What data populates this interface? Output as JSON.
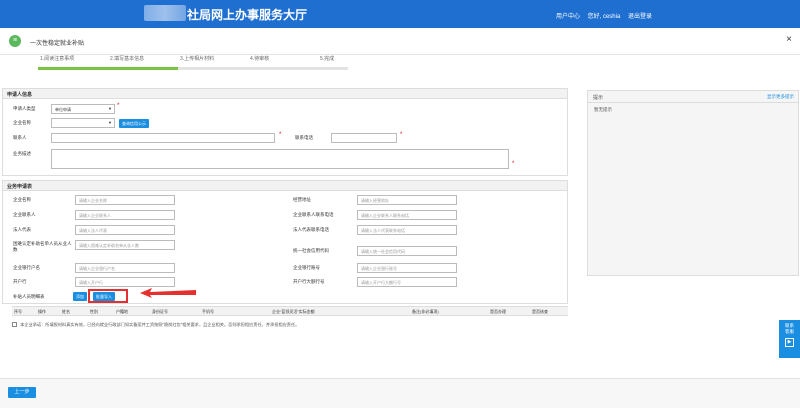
{
  "header": {
    "title": "社局网上办事服务大厅",
    "user_center": "用户中心",
    "user_name": "您好, ceshia",
    "logout": "退出登录"
  },
  "form": {
    "title": "一次性稳定就业补贴",
    "close": "×"
  },
  "steps": [
    {
      "label": "1.阅读注意事项",
      "done": true
    },
    {
      "label": "2.填写基本信息",
      "done": true
    },
    {
      "label": "3.上传相片材料",
      "done": false
    },
    {
      "label": "4.待审核",
      "done": false
    },
    {
      "label": "5.完成",
      "done": false
    }
  ],
  "applicant": {
    "section_title": "申请人信息",
    "type_label": "申请人类型",
    "type_value": "单位申请",
    "company_label": "企业名称",
    "company_btn": "查询信用公示",
    "contact_label": "联系人",
    "phone_label": "联系电话",
    "desc_label": "业务描述"
  },
  "business": {
    "section_title": "业务申请表",
    "fields": [
      {
        "label": "企业名称",
        "placeholder": "请输入企业名称"
      },
      {
        "label": "经营地址",
        "placeholder": "请输入经营地址"
      },
      {
        "label": "企业联系人",
        "placeholder": "请输入企业联系人"
      },
      {
        "label": "企业联系人联系电话",
        "placeholder": "请输入企业联系人联系电话"
      },
      {
        "label": "法人代表",
        "placeholder": "请输入法人代表"
      },
      {
        "label": "法人代表联系电话",
        "placeholder": "请输入法人代表联系电话"
      },
      {
        "label": "困难认定补助名单人员从业人数",
        "placeholder": "请输入困难认定补助名单从业人数"
      },
      {
        "label": "统一社会信用代码",
        "placeholder": "请输入统一社会信用代码"
      },
      {
        "label": "企业银行户名",
        "placeholder": "请输入企业银行户名"
      },
      {
        "label": "企业银行账号",
        "placeholder": "请输入企业银行账号"
      },
      {
        "label": "开户行",
        "placeholder": "请输入开户行"
      },
      {
        "label": "开户行大额行号",
        "placeholder": "请输入开户行大额行号"
      }
    ],
    "subsidy_label": "补贴人员明细表",
    "add_btn": "添加",
    "batch_btn": "批量导入"
  },
  "table": {
    "columns": [
      "序号",
      "操作",
      "姓名",
      "性别",
      "户籍地",
      "身份证号",
      "手机号",
      "企业“蓝领灵活”实际金额",
      "备注(非必填项)",
      "是否办理",
      "是否核查"
    ]
  },
  "agreement": "本企业承诺：所填报材料真实有效，已经向就业行政部门如实备案并工资按照“稳岗红包”相关要求，且企业相关。否则承担相应责任，并承担相应责任。",
  "tips": {
    "title": "提示",
    "toggle": "显示更多提示",
    "content": "暂无提示"
  },
  "side_tab": {
    "label_line1": "联系",
    "label_line2": "客服"
  },
  "footer": {
    "prev": "上一步"
  },
  "colors": {
    "header": "#1f6fd1",
    "accent": "#1a8ee0",
    "step_done": "#7cc242",
    "required": "#e40000",
    "annotation": "#e53030"
  }
}
